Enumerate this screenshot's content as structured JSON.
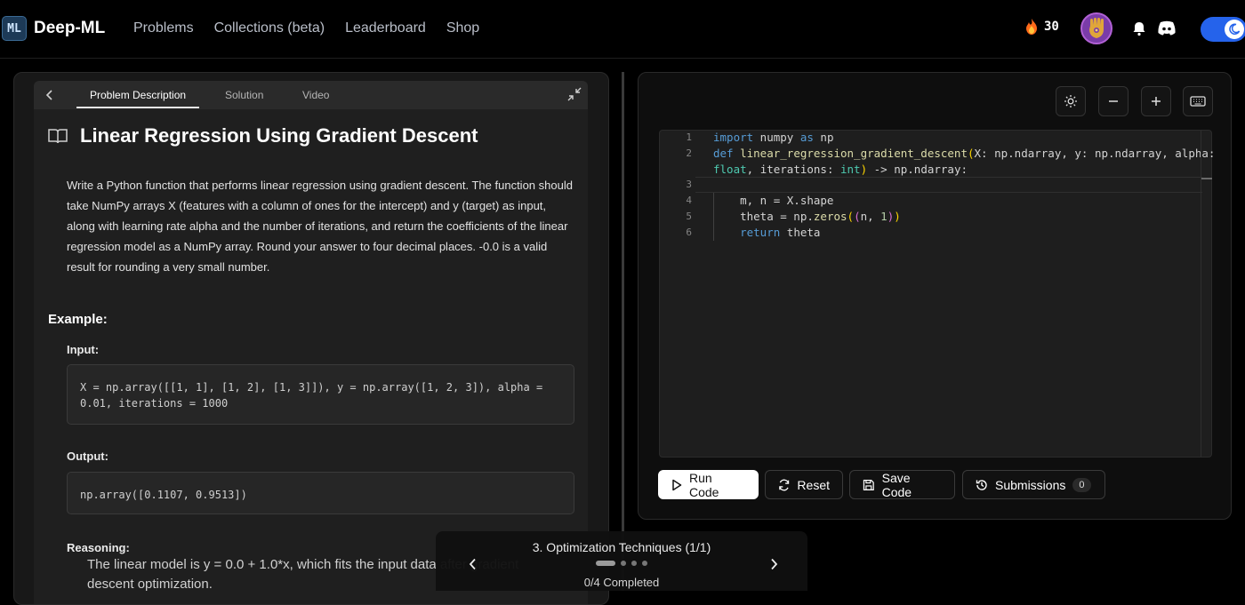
{
  "brand": {
    "name": "Deep-ML",
    "mark": "ML"
  },
  "nav": {
    "items": [
      "Problems",
      "Collections (beta)",
      "Leaderboard",
      "Shop"
    ]
  },
  "header": {
    "streak_count": "30",
    "streak_icon": "flame-icon",
    "avatar_icon": "hamsa-avatar",
    "theme_mode": "dark"
  },
  "problem_tabs": [
    "Problem Description",
    "Solution",
    "Video"
  ],
  "problem": {
    "title": "Linear Regression Using Gradient Descent",
    "description": "Write a Python function that performs linear regression using gradient descent. The function should take NumPy arrays X (features with a column of ones for the intercept) and y (target) as input, along with learning rate alpha and the number of iterations, and return the coefficients of the linear regression model as a NumPy array. Round your answer to four decimal places. -0.0 is a valid result for rounding a very small number.",
    "example_heading": "Example:",
    "input_label": "Input:",
    "input_code": "X = np.array([[1, 1], [1, 2], [1, 3]]), y = np.array([1, 2, 3]), alpha = 0.01, iterations = 1000",
    "output_label": "Output:",
    "output_code": "np.array([0.1107, 0.9513])",
    "reasoning_label": "Reasoning:",
    "reasoning_text": "The linear model is y = 0.0 + 1.0*x, which fits the input data after gradient descent optimization."
  },
  "editor": {
    "line_numbers": [
      "1",
      "2",
      "",
      "3",
      "4",
      "5",
      "6"
    ],
    "lines": [
      "import numpy as np",
      "def linear_regression_gradient_descent(X: np.ndarray, y: np.ndarray, alpha:",
      "float, iterations: int) -> np.ndarray:",
      "",
      "    m, n = X.shape",
      "    theta = np.zeros((n, 1))",
      "    return theta"
    ]
  },
  "actions": {
    "run": "Run Code",
    "reset": "Reset",
    "save": "Save Code",
    "submissions": "Submissions",
    "submissions_count": "0"
  },
  "progress": {
    "title": "3. Optimization Techniques (1/1)",
    "status": "0/4 Completed",
    "dots": 4,
    "active_dot": 0
  }
}
